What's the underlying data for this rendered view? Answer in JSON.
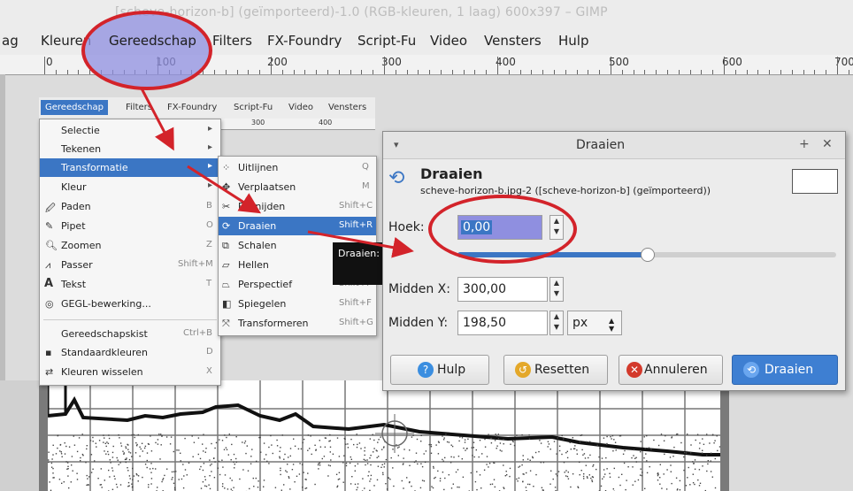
{
  "window": {
    "title": "[scheve-horizon-b] (geïmporteerd)-1.0 (RGB-kleuren, 1 laag) 600x397 – GIMP"
  },
  "menubar": [
    "ag",
    "Kleuren",
    "Gereedschap",
    "Filters",
    "FX-Foundry",
    "Script-Fu",
    "Video",
    "Vensters",
    "Hulp"
  ],
  "ruler": [
    "0",
    "100",
    "200",
    "300",
    "400",
    "500",
    "600",
    "700"
  ],
  "small_menubar": [
    "Gereedschap",
    "Filters",
    "FX-Foundry",
    "Script-Fu",
    "Video",
    "Vensters"
  ],
  "small_ruler": [
    "300",
    "400"
  ],
  "tools_menu": {
    "items": [
      {
        "label": "Selectie",
        "shortcut": "",
        "arrow": "▸"
      },
      {
        "label": "Tekenen",
        "shortcut": "",
        "arrow": "▸"
      },
      {
        "label": "Transformatie",
        "shortcut": "",
        "arrow": "▸"
      },
      {
        "label": "Kleur",
        "shortcut": "",
        "arrow": "▸"
      },
      {
        "label": "Paden",
        "shortcut": "B",
        "arrow": ""
      },
      {
        "label": "Pipet",
        "shortcut": "O",
        "arrow": ""
      },
      {
        "label": "Zoomen",
        "shortcut": "Z",
        "arrow": ""
      },
      {
        "label": "Passer",
        "shortcut": "Shift+M",
        "arrow": ""
      },
      {
        "label": "Tekst",
        "shortcut": "T",
        "arrow": ""
      },
      {
        "label": "GEGL-bewerking...",
        "shortcut": "",
        "arrow": ""
      },
      {
        "label": "Gereedschapskist",
        "shortcut": "Ctrl+B",
        "arrow": ""
      },
      {
        "label": "Standaardkleuren",
        "shortcut": "D",
        "arrow": ""
      },
      {
        "label": "Kleuren wisselen",
        "shortcut": "X",
        "arrow": ""
      }
    ]
  },
  "transform_menu": {
    "items": [
      {
        "label": "Uitlijnen",
        "shortcut": "Q"
      },
      {
        "label": "Verplaatsen",
        "shortcut": "M"
      },
      {
        "label": "Bijsnijden",
        "shortcut": "Shift+C"
      },
      {
        "label": "Draaien",
        "shortcut": "Shift+R"
      },
      {
        "label": "Schalen",
        "shortcut": "Shift+T"
      },
      {
        "label": "Hellen",
        "shortcut": "Shift+S"
      },
      {
        "label": "Perspectief",
        "shortcut": "Shift+P"
      },
      {
        "label": "Spiegelen",
        "shortcut": "Shift+F"
      },
      {
        "label": "Transformeren",
        "shortcut": "Shift+G"
      }
    ]
  },
  "tooltip": "Draaien:",
  "dialog": {
    "title": "Draaien",
    "heading": "Draaien",
    "subtitle": "scheve-horizon-b.jpg-2 ([scheve-horizon-b] (geïmporteerd))",
    "angle_label": "Hoek:",
    "angle_value": "0,00",
    "angle_level": 0.5,
    "center_x_label": "Midden X:",
    "center_x_value": "300,00",
    "center_y_label": "Midden Y:",
    "center_y_value": "198,50",
    "unit": "px",
    "buttons": {
      "help": "Hulp",
      "reset": "Resetten",
      "cancel": "Annuleren",
      "ok": "Draaien"
    }
  },
  "colors": {
    "accent": "#3b76c4",
    "annotation_red": "#d3232a",
    "oval_fill": "#8f8fe0"
  }
}
